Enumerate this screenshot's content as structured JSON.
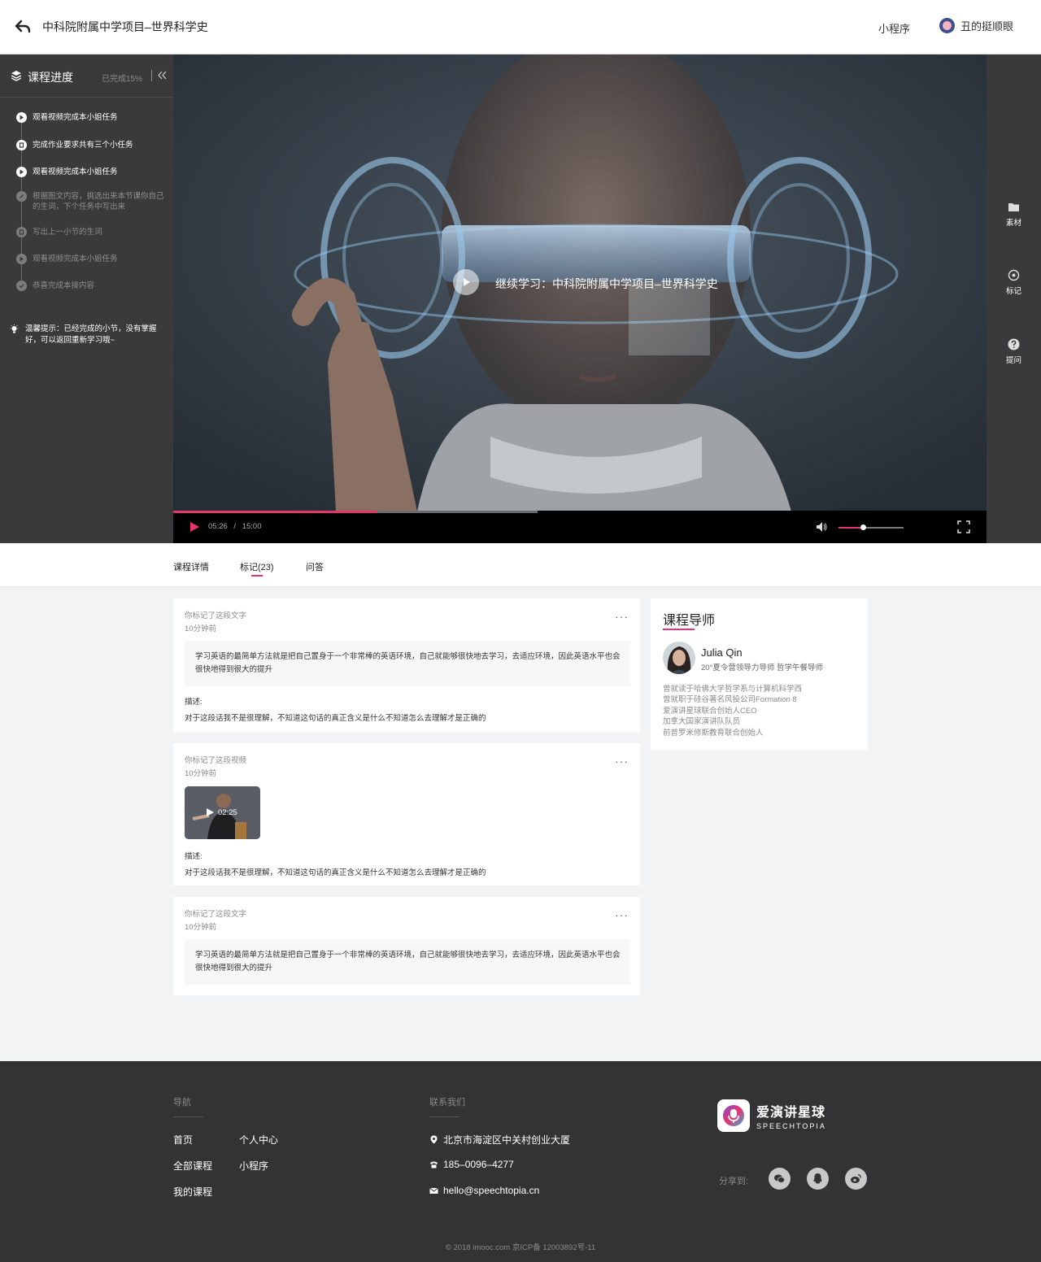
{
  "header": {
    "title": "中科院附属中学项目–世界科学史",
    "mini_program": "小程序",
    "user_name": "丑的挺顺眼"
  },
  "sidebar": {
    "title": "课程进度",
    "progress_text": "已完成15%",
    "tasks": [
      {
        "label": "观看视频完成本小姐任务",
        "icon": "play-icon",
        "state": "active"
      },
      {
        "label": "完成作业要求共有三个小任务",
        "icon": "task-icon",
        "state": "active"
      },
      {
        "label": "观看视频完成本小姐任务",
        "icon": "play-icon",
        "state": "active"
      },
      {
        "label": "根据图文内容，挑选出来本节课你自己的生词，下个任务中写出来",
        "icon": "edit-icon",
        "state": "pending"
      },
      {
        "label": "写出上一小节的生词",
        "icon": "task-icon",
        "state": "pending"
      },
      {
        "label": "观看视频完成本小姐任务",
        "icon": "play-icon",
        "state": "pending"
      },
      {
        "label": "恭喜完成本接内容",
        "icon": "check-icon",
        "state": "pending"
      }
    ],
    "tip": "温馨提示：已经完成的小节，没有掌握好，可以返回重新学习哦~"
  },
  "video": {
    "overlay_text": "继续学习：中科院附属中学项目–世界科学史",
    "current_time": "05:26",
    "separator": "/",
    "duration": "15:00",
    "played_fraction": 0.25,
    "buffered_fraction": 0.448,
    "volume_fraction": 0.38
  },
  "tools": [
    {
      "label": "素材",
      "icon": "folder-icon"
    },
    {
      "label": "标记",
      "icon": "mark-icon"
    },
    {
      "label": "提问",
      "icon": "question-icon"
    }
  ],
  "tabs": [
    {
      "label": "课程详情",
      "active": false
    },
    {
      "label": "标记(23)",
      "active": true
    },
    {
      "label": "问答",
      "active": false
    }
  ],
  "notes": [
    {
      "meta": "你标记了这段文字",
      "time": "10分钟前",
      "more": "···",
      "quote": "学习英语的最简单方法就是把自己置身于一个非常棒的英语环境，自己就能够很快地去学习，去适应环境，因此英语水平也会很快地得到很大的提升",
      "desc_label": "描述:",
      "desc": "对于这段话我不是很理解，不知道这句话的真正含义是什么不知道怎么去理解才是正确的"
    },
    {
      "meta": "你标记了这段视频",
      "time": "10分钟前",
      "more": "···",
      "clip_time": "02:25",
      "desc_label": "描述:",
      "desc": "对于这段话我不是很理解，不知道这句话的真正含义是什么不知道怎么去理解才是正确的"
    },
    {
      "meta": "你标记了这段文字",
      "time": "10分钟前",
      "more": "···",
      "quote": "学习英语的最简单方法就是把自己置身于一个非常棒的英语环境，自己就能够很快地去学习，去适应环境，因此英语水平也会很快地得到很大的提升"
    }
  ],
  "mentor": {
    "title": "课程导师",
    "name": "Julia Qin",
    "role": "20°夏令营领导力导师  哲学午餐导师",
    "bio": [
      "曾就读于哈佛大学哲学系与计算机科学西",
      "曾就职于硅谷著名风投公司Formation 8",
      "爱演讲星球联合创始人CEO",
      "加拿大国家演讲队队员",
      "前普罗米修斯教育联合创始人"
    ]
  },
  "footer": {
    "nav_title": "导航",
    "nav_links": [
      "首页",
      "个人中心",
      "全部课程",
      "小程序",
      "我的课程"
    ],
    "contact_title": "联系我们",
    "address": "北京市海淀区中关村创业大厦",
    "phone": "185–0096–4277",
    "email": "hello@speechtopia.cn",
    "brand_cn": "爱演讲星球",
    "brand_en": "SPEECHTOPIA",
    "share_label": "分享到:",
    "share_icons": [
      "wechat-icon",
      "qq-icon",
      "weibo-icon"
    ],
    "copyright": "© 2018 imooc.com  京ICP备 12003892号-11"
  },
  "colors": {
    "accent": "#e8336d",
    "sidebar_bg": "#3a3a3c",
    "footer_bg": "#333335"
  }
}
